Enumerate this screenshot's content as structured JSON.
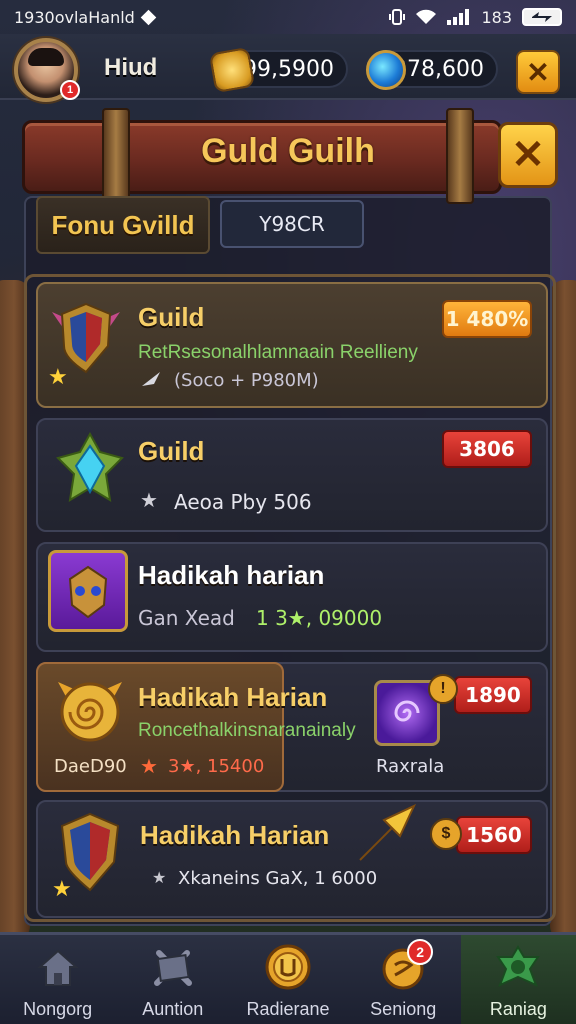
{
  "status_bar": {
    "left_text": "1930ovlaHanld",
    "right_text": "183"
  },
  "player": {
    "name": "Hiud",
    "notification_count": "1"
  },
  "currencies": {
    "gold": "99,5900",
    "gems": "378,600"
  },
  "banner": {
    "title": "Guld Guilh"
  },
  "tabs": {
    "guild_tab": "Fonu Gvilld",
    "search_tab": "Y98CR"
  },
  "guilds": [
    {
      "name": "Guild",
      "subtitle": "RetRsesonalhlamnaain Reellieny",
      "meta": "(Soco + P980M)",
      "badge": "1 480%",
      "badge_color": "#e07a10"
    },
    {
      "name": "Guild",
      "meta": "Aeoa Pby 506",
      "badge": "3806",
      "badge_color": "#b01e1a"
    },
    {
      "name": "Hadikah harian",
      "meta_prefix": "Gan Xead",
      "meta_value": "1 3★, 09000"
    },
    {
      "name": "Hadikah Harian",
      "subtitle": "Roncethalkinsnaranainaly",
      "left_label": "DaeD90",
      "meta_value": "3★, 15400",
      "side_label": "Raxrala",
      "badge": "1890",
      "badge_color": "#b01e1a"
    },
    {
      "name": "Hadikah Harian",
      "meta": "Xkaneins GaX, 1 6000",
      "badge": "1560",
      "badge_color": "#b01e1a"
    }
  ],
  "bottom_nav": [
    {
      "label": "Nongorg",
      "icon": "house-icon"
    },
    {
      "label": "Auntion",
      "icon": "crossed-swords-icon"
    },
    {
      "label": "Radierane",
      "icon": "guild-coin-icon"
    },
    {
      "label": "Seniong",
      "icon": "gold-pouch-icon",
      "badge": "2"
    },
    {
      "label": "Raniag",
      "icon": "green-crest-icon"
    }
  ]
}
